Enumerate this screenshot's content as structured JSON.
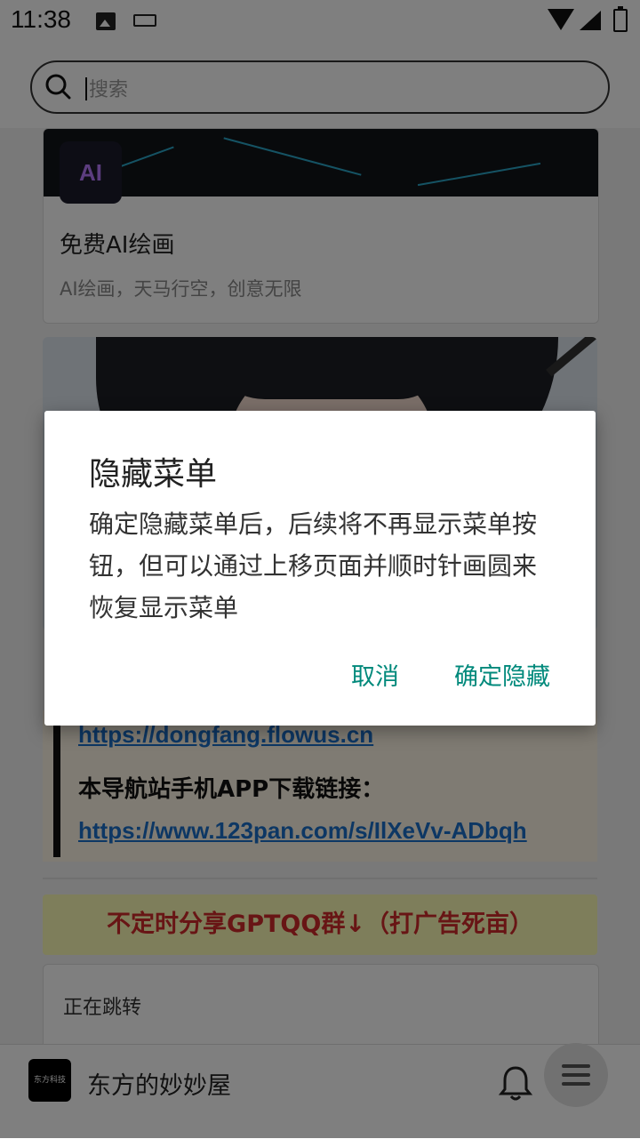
{
  "status_bar": {
    "time": "11:38"
  },
  "search": {
    "placeholder": "搜索"
  },
  "cards": [
    {
      "title": "免费AI绘画",
      "desc": "AI绘画，天马行空，创意无限",
      "logo_text": "AI"
    }
  ],
  "links": {
    "link1": "https://dongfang.flowus.cn",
    "label": "本导航站手机APP下载链接：",
    "link2": "https://www.123pan.com/s/IlXeVv-ADbqh"
  },
  "gpt_banner": "不定时分享GPTQQ群↓（打广告死亩）",
  "redirect": {
    "text": "正在跳转"
  },
  "bottom_bar": {
    "site_name": "东方的妙妙屋",
    "logo_text": "东方科技"
  },
  "dialog": {
    "title": "隐藏菜单",
    "message": "确定隐藏菜单后，后续将不再显示菜单按钮，但可以通过上移页面并顺时针画圆来恢复显示菜单",
    "cancel": "取消",
    "confirm": "确定隐藏"
  },
  "colors": {
    "accent": "#00897b",
    "link": "#1a6fc8",
    "warning_text": "#d12a2a",
    "banner_bg": "#fdfdb6"
  }
}
